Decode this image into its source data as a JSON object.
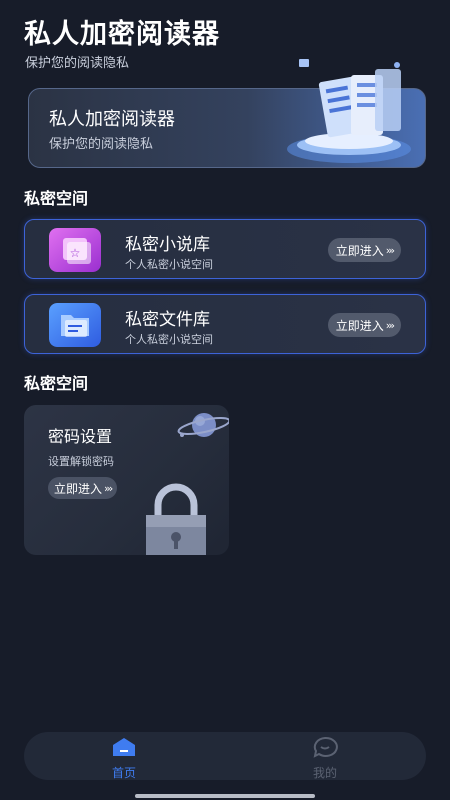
{
  "header": {
    "title": "私人加密阅读器",
    "subtitle": "保护您的阅读隐私"
  },
  "hero": {
    "title": "私人加密阅读器",
    "subtitle": "保护您的阅读隐私",
    "art_icon": "server-database-icon"
  },
  "sections": {
    "private_space": "私密空间",
    "private_space_2": "私密空间"
  },
  "libraries": [
    {
      "title": "私密小说库",
      "subtitle": "个人私密小说空间",
      "button": "立即进入",
      "icon": "star-book-icon",
      "icon_color": "#c34de6"
    },
    {
      "title": "私密文件库",
      "subtitle": "个人私密小说空间",
      "button": "立即进入",
      "icon": "folder-file-icon",
      "icon_color": "#3b6df0"
    }
  ],
  "password_card": {
    "title": "密码设置",
    "subtitle": "设置解锁密码",
    "button": "立即进入",
    "icon": "lock-icon"
  },
  "bottom_nav": {
    "items": [
      {
        "label": "首页",
        "icon": "home-icon",
        "active": true
      },
      {
        "label": "我的",
        "icon": "chat-bubble-icon",
        "active": false
      }
    ]
  },
  "colors": {
    "background": "#171c29",
    "accent_blue": "#3d63d8",
    "active_nav": "#3f7cf0",
    "inactive_nav": "#5b6272"
  }
}
